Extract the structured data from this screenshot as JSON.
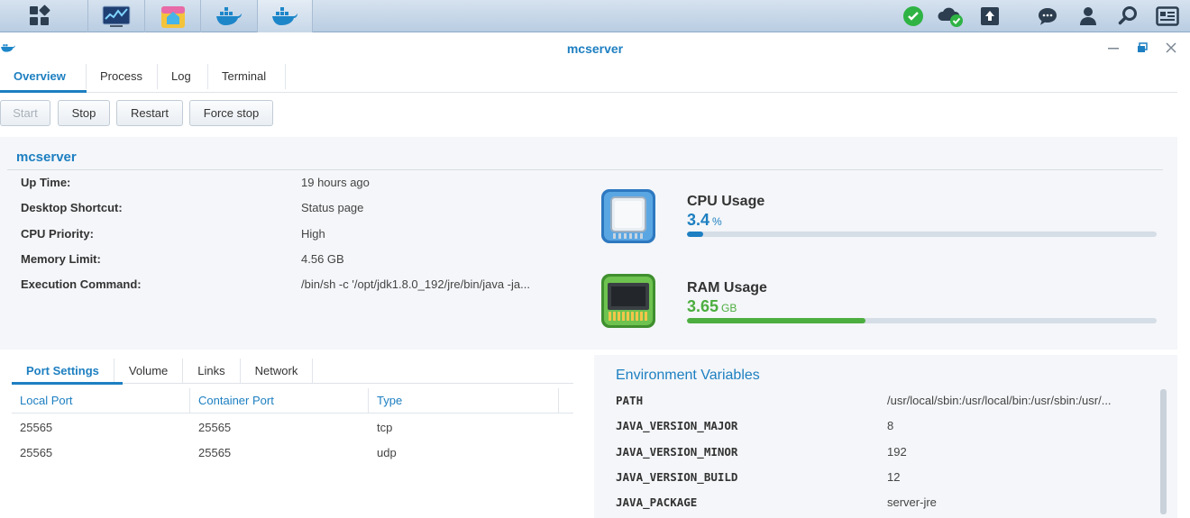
{
  "taskbar": {
    "apps": [
      {
        "icon": "main-menu-icon"
      },
      {
        "icon": "resource-monitor-icon"
      },
      {
        "icon": "package-center-icon"
      },
      {
        "icon": "docker-icon"
      },
      {
        "icon": "docker-icon"
      }
    ],
    "tray": [
      "status-ok-icon",
      "cloud-sync-icon",
      "upload-icon",
      "chat-icon",
      "user-icon",
      "search-icon",
      "widgets-icon"
    ]
  },
  "window": {
    "title": "mcserver",
    "tabs": [
      "Overview",
      "Process",
      "Log",
      "Terminal"
    ],
    "active_tab": "Overview",
    "actions": [
      "Start",
      "Stop",
      "Restart",
      "Force stop"
    ]
  },
  "overview": {
    "name": "mcserver",
    "fields": [
      {
        "label": "Up Time:",
        "value": "19 hours ago"
      },
      {
        "label": "Desktop Shortcut:",
        "value": "Status page"
      },
      {
        "label": "CPU Priority:",
        "value": "High"
      },
      {
        "label": "Memory Limit:",
        "value": "4.56 GB"
      },
      {
        "label": "Execution Command:",
        "value": "/bin/sh -c '/opt/jdk1.8.0_192/jre/bin/java -ja..."
      }
    ],
    "cpu": {
      "label": "CPU Usage",
      "value": "3.4",
      "unit": "%",
      "fraction": 0.034,
      "color": "#1d7fc1"
    },
    "ram": {
      "label": "RAM Usage",
      "value": "3.65",
      "unit": "GB",
      "fraction": 0.38,
      "color": "#4cae3f"
    }
  },
  "ports": {
    "tabs": [
      "Port Settings",
      "Volume",
      "Links",
      "Network"
    ],
    "active_tab": "Port Settings",
    "columns": [
      "Local Port",
      "Container Port",
      "Type"
    ],
    "rows": [
      [
        "25565",
        "25565",
        "tcp"
      ],
      [
        "25565",
        "25565",
        "udp"
      ]
    ]
  },
  "env": {
    "title": "Environment Variables",
    "rows": [
      {
        "key": "PATH",
        "value": "/usr/local/sbin:/usr/local/bin:/usr/sbin:/usr/..."
      },
      {
        "key": "JAVA_VERSION_MAJOR",
        "value": "8"
      },
      {
        "key": "JAVA_VERSION_MINOR",
        "value": "192"
      },
      {
        "key": "JAVA_VERSION_BUILD",
        "value": "12"
      },
      {
        "key": "JAVA_PACKAGE",
        "value": "server-jre"
      }
    ]
  }
}
